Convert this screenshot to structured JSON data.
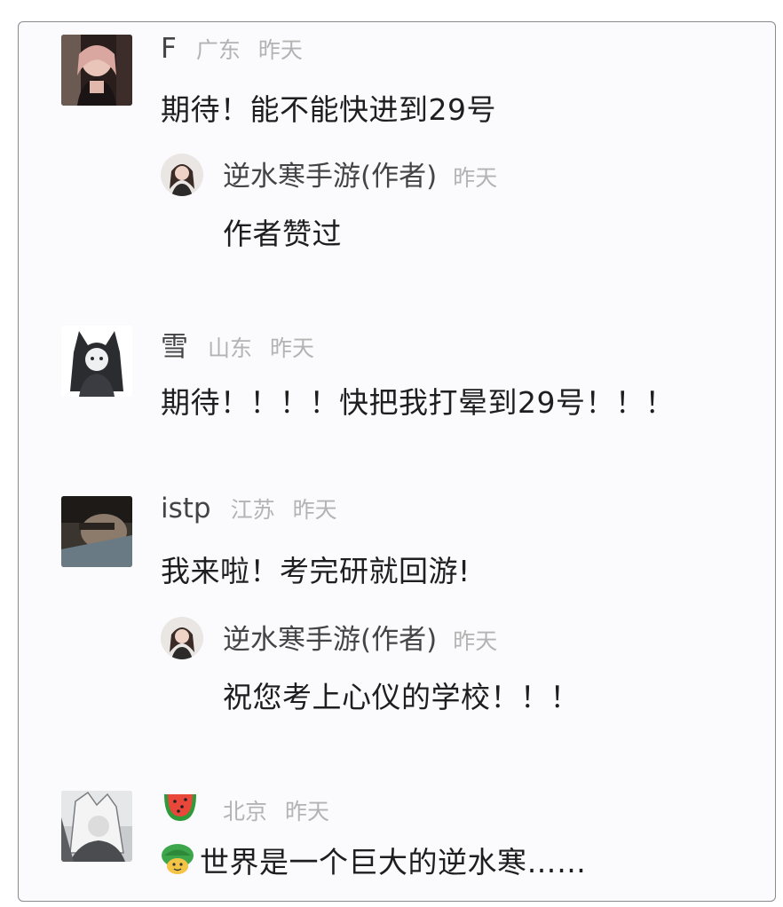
{
  "comments": [
    {
      "username": "F",
      "location": "广东",
      "time": "昨天",
      "text": "期待！能不能快进到29号",
      "reply": {
        "username": "逆水寒手游(作者)",
        "time": "昨天",
        "text": "作者赞过"
      }
    },
    {
      "username": "雪",
      "location": "山东",
      "time": "昨天",
      "text": "期待！！！！快把我打晕到29号！！！"
    },
    {
      "username": "istp",
      "location": "江苏",
      "time": "昨天",
      "text": "我来啦！考完研就回游!",
      "reply": {
        "username": "逆水寒手游(作者)",
        "time": "昨天",
        "text": "祝您考上心仪的学校！！！"
      }
    },
    {
      "username_icon": "watermelon-icon",
      "location": "北京",
      "time": "昨天",
      "text_icon": "turtle-icon",
      "text": "世界是一个巨大的逆水寒……"
    }
  ],
  "colors": {
    "username": "#444444",
    "meta": "#b3b3b3",
    "text": "#1e1e1e",
    "border": "#8a8a8a"
  }
}
